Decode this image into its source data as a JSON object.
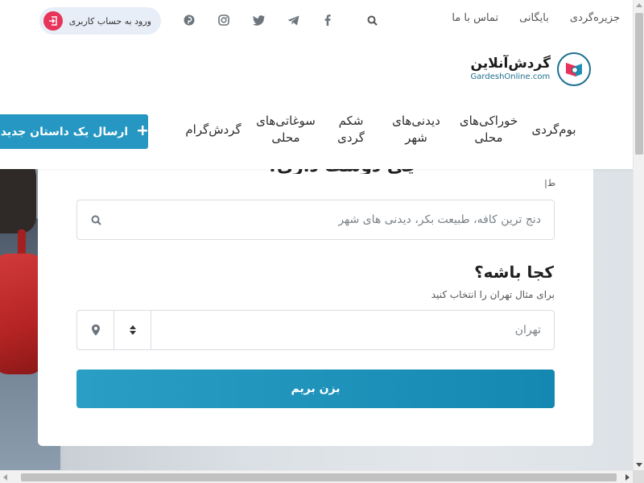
{
  "topbar": {
    "links": [
      "جزیره‌گردی",
      "بایگانی",
      "تماس با ما"
    ],
    "search_icon": "search-icon",
    "social_icons": [
      "pinterest-icon",
      "instagram-icon",
      "twitter-icon",
      "telegram-icon",
      "facebook-icon"
    ],
    "login_label": "ورود به حساب کاربری",
    "login_icon": "login-icon"
  },
  "logo": {
    "name_fa": "گردش‌آنلاین",
    "name_en": "GardeshOnline.com"
  },
  "nav": {
    "items": [
      "بوم‌گردی",
      "خوراکی‌های\nمحلی",
      "دیدنی‌های\nشهر",
      "شکم\nگردی",
      "سوغاتی‌های\nمحلی",
      "گردش‌گرام"
    ]
  },
  "post_button": {
    "label": "ارسال یک داستان جدید",
    "icon": "plus-icon"
  },
  "search_card": {
    "cut_heading": "چی دوست داری؟",
    "tiny_label": "ط|",
    "search_placeholder": "دنج ترین کافه، طبیعت بکر، دیدنی های شهر",
    "where_title": "کجا باشه؟",
    "where_subtitle": "برای مثال تهران را انتخاب کنید",
    "city_value": "تهران",
    "submit_label": "بزن بریم"
  },
  "colors": {
    "accent": "#2597c2",
    "login_icon_bg": "#e8335b",
    "logo_ring": "#1d6f8f"
  }
}
